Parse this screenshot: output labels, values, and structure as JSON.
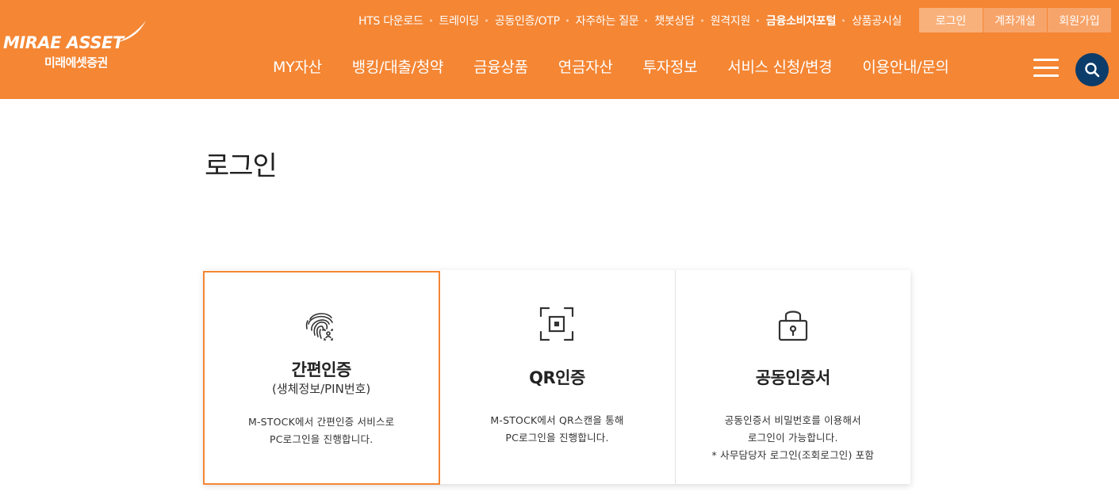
{
  "brand": {
    "logo_text": "MIRAE ASSET",
    "logo_sub": "미래에셋증권",
    "accent": "#f48634",
    "navy": "#0c3c6a"
  },
  "util_links": [
    {
      "label": "HTS 다운로드",
      "bold": false
    },
    {
      "label": "트레이딩",
      "bold": false
    },
    {
      "label": "공동인증/OTP",
      "bold": false
    },
    {
      "label": "자주하는 질문",
      "bold": false
    },
    {
      "label": "챗봇상담",
      "bold": false
    },
    {
      "label": "원격지원",
      "bold": false
    },
    {
      "label": "금융소비자포털",
      "bold": true
    },
    {
      "label": "상품공시실",
      "bold": false
    }
  ],
  "util_buttons": {
    "login": "로그인",
    "open_account": "계좌개설",
    "join": "회원가입"
  },
  "gnb": [
    "MY자산",
    "뱅킹/대출/청약",
    "금융상품",
    "연금자산",
    "투자정보",
    "서비스 신청/변경",
    "이용안내/문의"
  ],
  "icons": {
    "menu": "hamburger-menu-icon",
    "search": "search-icon",
    "card1": "fingerprint-icon",
    "card2": "qr-scan-icon",
    "card3": "lock-icon"
  },
  "page": {
    "title": "로그인"
  },
  "cards": [
    {
      "title": "간편인증",
      "subtitle": "(생체정보/PIN번호)",
      "desc_line1": "M-STOCK에서 간편인증 서비스로",
      "desc_line2": "PC로그인을 진행합니다.",
      "desc_line3": ""
    },
    {
      "title": "QR인증",
      "subtitle": "",
      "desc_line1": "M-STOCK에서 QR스캔을 통해",
      "desc_line2": "PC로그인을 진행합니다.",
      "desc_line3": ""
    },
    {
      "title": "공동인증서",
      "subtitle": "",
      "desc_line1": "공동인증서 비밀번호를 이용해서",
      "desc_line2": "로그인이 가능합니다.",
      "desc_line3": "* 사무담당자 로그인(조회로그인) 포함"
    }
  ]
}
